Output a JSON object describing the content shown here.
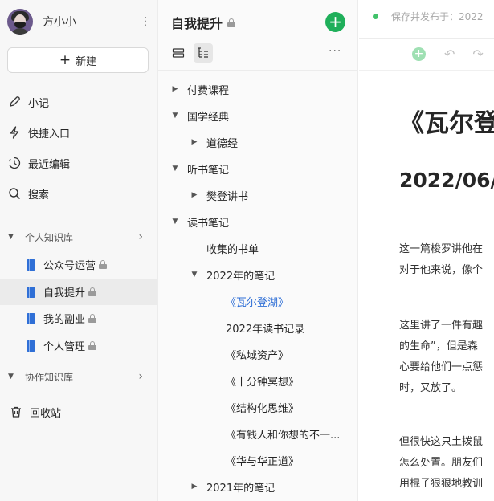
{
  "sidebar": {
    "user_name": "方小小",
    "new_button": "新建",
    "nav": [
      {
        "label": "小记",
        "icon": "pen-icon"
      },
      {
        "label": "快捷入口",
        "icon": "lightning-icon"
      },
      {
        "label": "最近编辑",
        "icon": "clock-icon"
      },
      {
        "label": "搜索",
        "icon": "search-icon"
      }
    ],
    "personal_section": "个人知识库",
    "knowledge_bases": [
      {
        "label": "公众号运营",
        "active": false
      },
      {
        "label": "自我提升",
        "active": true
      },
      {
        "label": "我的副业",
        "active": false
      },
      {
        "label": "个人管理",
        "active": false
      }
    ],
    "collab_section": "协作知识库",
    "trash": "回收站"
  },
  "tree": {
    "title": "自我提升",
    "nodes": [
      {
        "label": "付费课程",
        "level": 0,
        "arrow": "collapsed"
      },
      {
        "label": "国学经典",
        "level": 0,
        "arrow": "expanded"
      },
      {
        "label": "道德经",
        "level": 1,
        "arrow": "collapsed"
      },
      {
        "label": "听书笔记",
        "level": 0,
        "arrow": "expanded"
      },
      {
        "label": "樊登讲书",
        "level": 1,
        "arrow": "collapsed"
      },
      {
        "label": "读书笔记",
        "level": 0,
        "arrow": "expanded"
      },
      {
        "label": "收集的书单",
        "level": 1,
        "arrow": "none"
      },
      {
        "label": "2022年的笔记",
        "level": 1,
        "arrow": "expanded"
      },
      {
        "label": "《瓦尔登湖》",
        "level": 2,
        "arrow": "none",
        "selected": true
      },
      {
        "label": "2022年读书记录",
        "level": 2,
        "arrow": "none"
      },
      {
        "label": "《私域资产》",
        "level": 2,
        "arrow": "none"
      },
      {
        "label": "《十分钟冥想》",
        "level": 2,
        "arrow": "none"
      },
      {
        "label": "《结构化思维》",
        "level": 2,
        "arrow": "none"
      },
      {
        "label": "《有钱人和你想的不一...",
        "level": 2,
        "arrow": "none"
      },
      {
        "label": "《华与华正道》",
        "level": 2,
        "arrow": "none"
      },
      {
        "label": "2021年的笔记",
        "level": 1,
        "arrow": "collapsed"
      }
    ]
  },
  "editor": {
    "status": "保存并发布于：2022",
    "title": "《瓦尔登",
    "subtitle": "2022/06/",
    "paragraphs": [
      [
        "这一篇梭罗讲他在",
        "对于他来说，像个"
      ],
      [
        "这里讲了一件有趣",
        "的生命”，但是森",
        "心要给他们一点惩",
        "时，又放了。"
      ],
      [
        "但很快这只土拨鼠",
        "怎么处置。朋友们",
        "用棍子狠狠地教训"
      ]
    ]
  }
}
